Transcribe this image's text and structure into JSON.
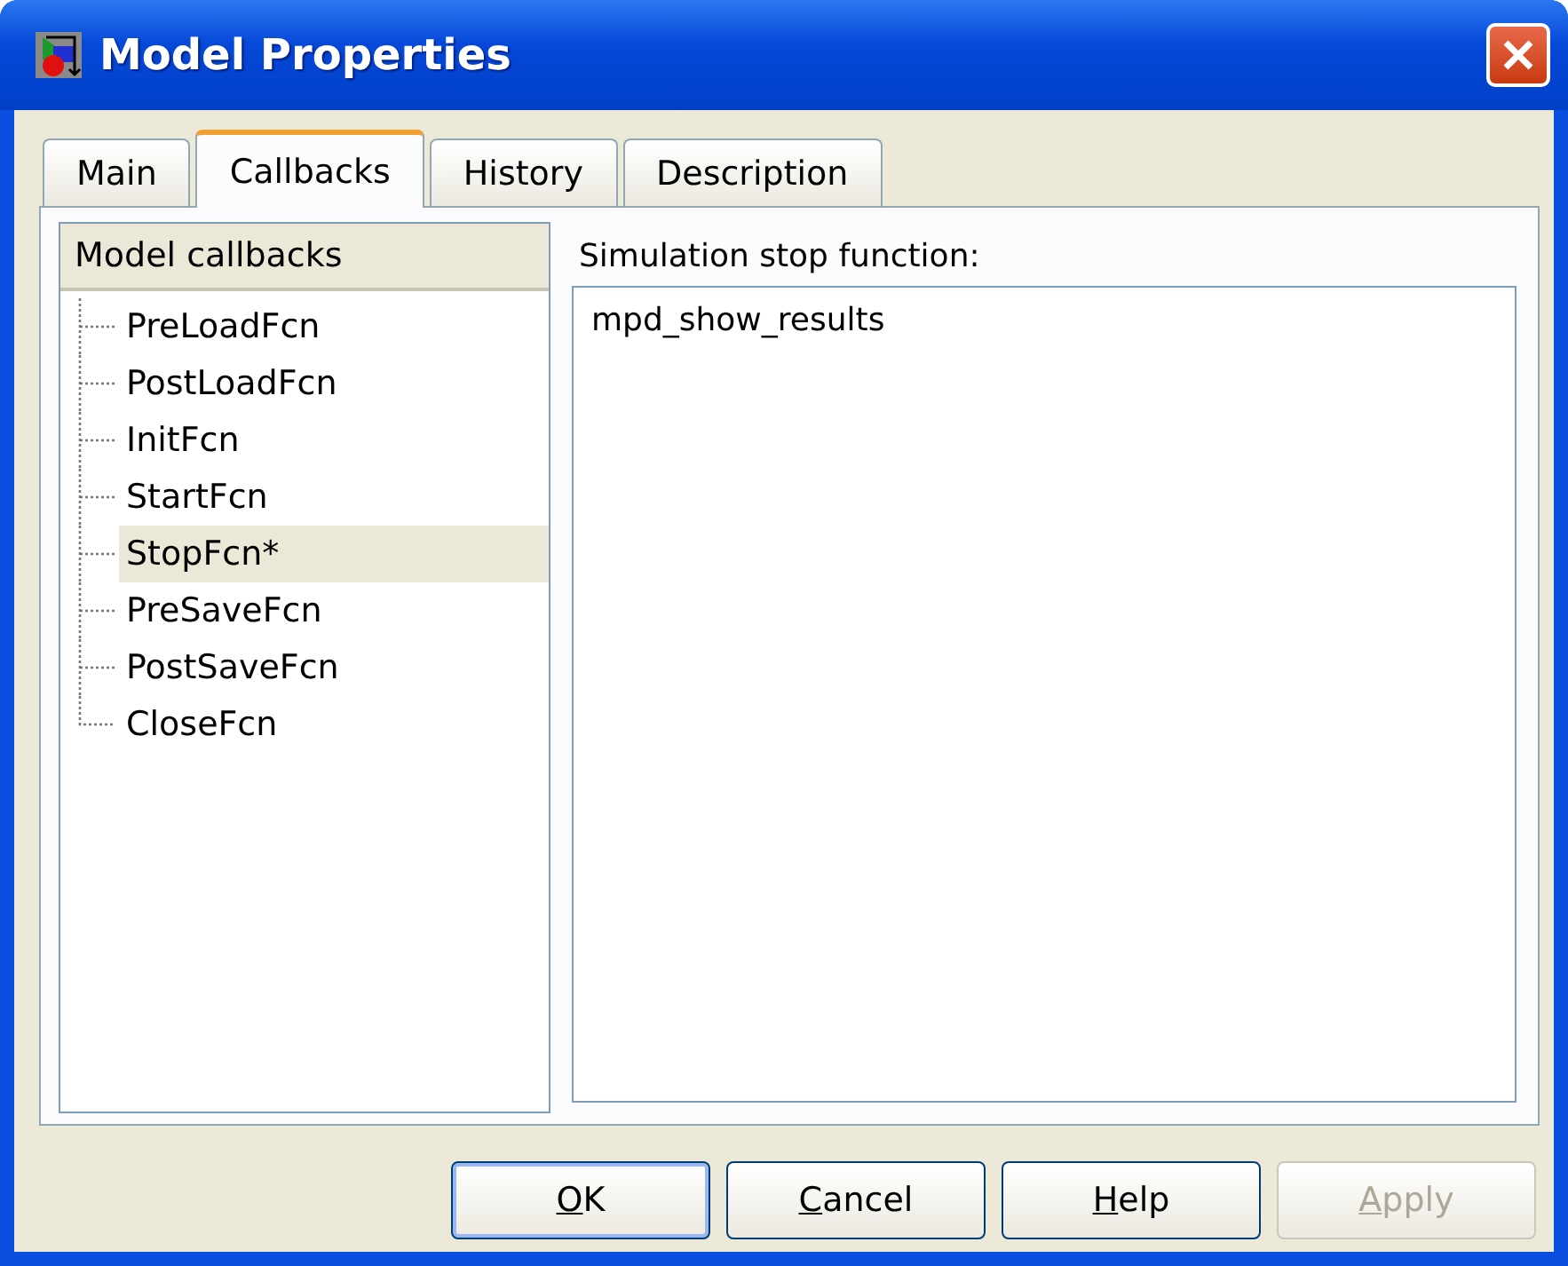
{
  "window": {
    "title": "Model Properties"
  },
  "tabs": [
    {
      "label": "Main",
      "selected": false
    },
    {
      "label": "Callbacks",
      "selected": true
    },
    {
      "label": "History",
      "selected": false
    },
    {
      "label": "Description",
      "selected": false
    }
  ],
  "tree": {
    "header": "Model callbacks",
    "items": [
      {
        "label": "PreLoadFcn",
        "selected": false
      },
      {
        "label": "PostLoadFcn",
        "selected": false
      },
      {
        "label": "InitFcn",
        "selected": false
      },
      {
        "label": "StartFcn",
        "selected": false
      },
      {
        "label": "StopFcn*",
        "selected": true
      },
      {
        "label": "PreSaveFcn",
        "selected": false
      },
      {
        "label": "PostSaveFcn",
        "selected": false
      },
      {
        "label": "CloseFcn",
        "selected": false
      }
    ]
  },
  "editor": {
    "label": "Simulation stop function:",
    "value": "mpd_show_results"
  },
  "buttons": [
    {
      "accel": "O",
      "rest": "K",
      "default": true,
      "disabled": false
    },
    {
      "accel": "C",
      "rest": "ancel",
      "default": false,
      "disabled": false
    },
    {
      "accel": "H",
      "rest": "elp",
      "default": false,
      "disabled": false
    },
    {
      "accel": "A",
      "rest": "pply",
      "default": false,
      "disabled": true
    }
  ]
}
